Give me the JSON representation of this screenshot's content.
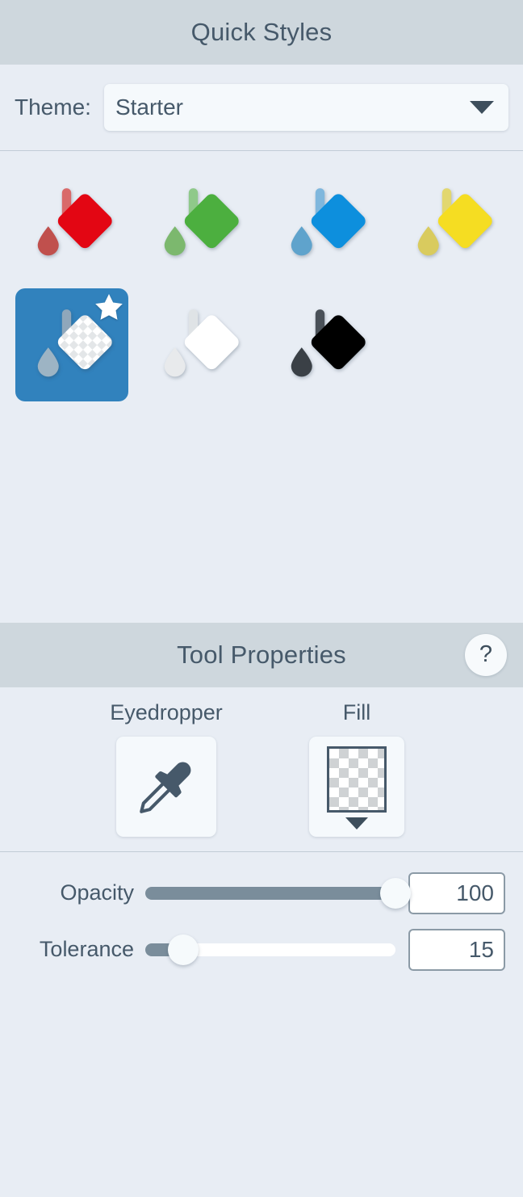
{
  "quick_styles": {
    "header_title": "Quick Styles",
    "theme": {
      "label": "Theme:",
      "value": "Starter",
      "caret_icon": "chevron-down-icon"
    },
    "swatches": [
      {
        "name": "Red",
        "color": "#e30613",
        "drop_color": "#c0504d",
        "handle_color": "#d96a6a",
        "selected": false,
        "favorite": false
      },
      {
        "name": "Green",
        "color": "#4caf3f",
        "drop_color": "#7cb86e",
        "handle_color": "#8fc98a",
        "selected": false,
        "favorite": false
      },
      {
        "name": "Blue",
        "color": "#0d8fdd",
        "drop_color": "#5fa3cc",
        "handle_color": "#7fb7dd",
        "selected": false,
        "favorite": false
      },
      {
        "name": "Yellow",
        "color": "#f5dd22",
        "drop_color": "#d9cb5e",
        "handle_color": "#e2d76f",
        "selected": false,
        "favorite": false
      },
      {
        "name": "Transparent",
        "color": "checker",
        "drop_color": "#9db4c4",
        "handle_color": "#8fa7bb",
        "selected": true,
        "favorite": true
      },
      {
        "name": "White",
        "color": "#ffffff",
        "drop_color": "#e8eaec",
        "handle_color": "#dfe3e6",
        "selected": false,
        "favorite": false
      },
      {
        "name": "Black",
        "color": "#000000",
        "drop_color": "#3a4046",
        "handle_color": "#4a5158",
        "selected": false,
        "favorite": false
      }
    ],
    "selected_badge_icon": "star-icon"
  },
  "tool_properties": {
    "header_title": "Tool Properties",
    "help_label": "?",
    "tools": [
      {
        "label": "Eyedropper",
        "icon": "eyedropper-icon"
      },
      {
        "label": "Fill",
        "icon": "checker-swatch-icon",
        "caret_icon": "chevron-down-icon"
      }
    ],
    "sliders": [
      {
        "label": "Opacity",
        "value": "100",
        "percent": 100,
        "min": 0,
        "max": 100
      },
      {
        "label": "Tolerance",
        "value": "15",
        "percent": 15,
        "min": 0,
        "max": 100
      }
    ]
  },
  "colors": {
    "header_bg": "#ced7dd",
    "panel_bg": "#e8edf4",
    "accent": "#3182bd",
    "text": "#46596a",
    "slider_fill": "#7a8d9b"
  }
}
